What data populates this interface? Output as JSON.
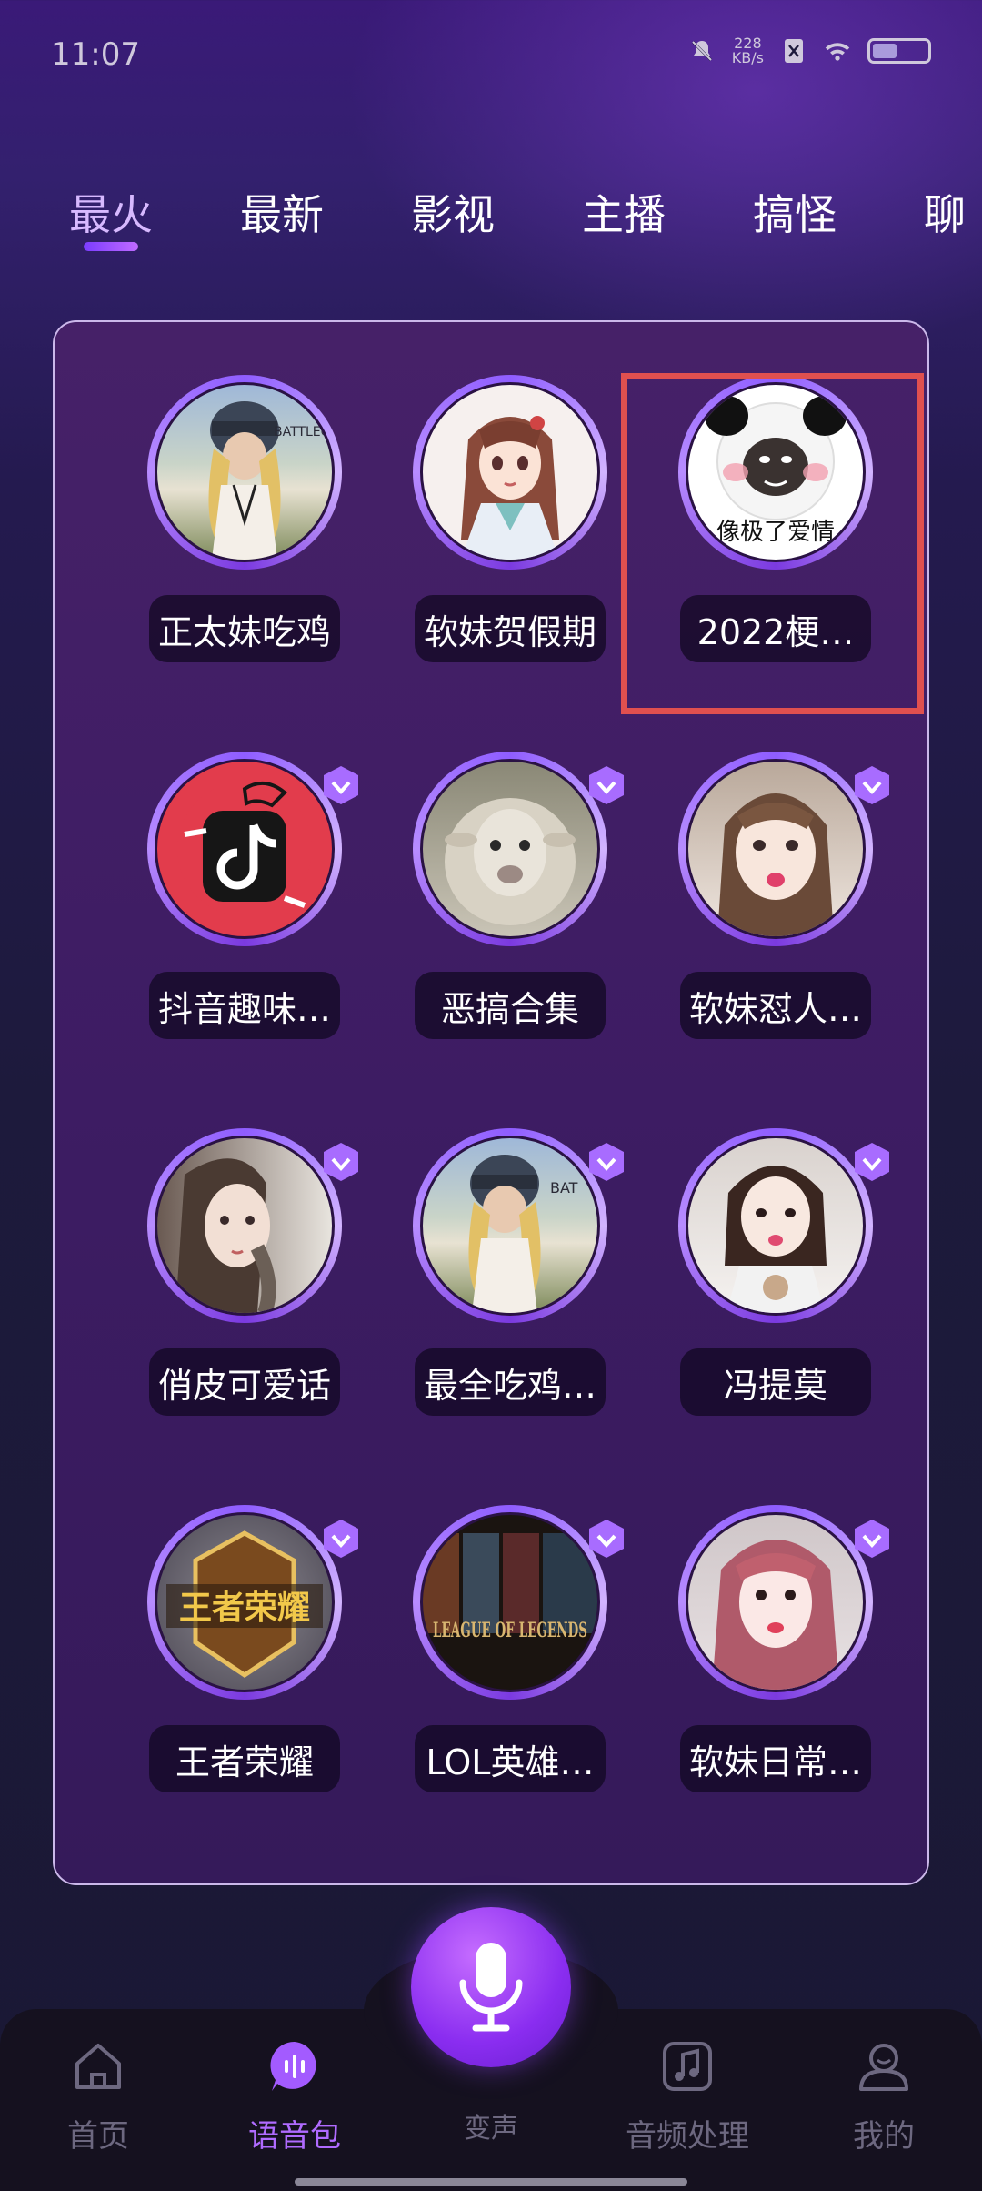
{
  "status_bar": {
    "time": "11:07",
    "net_speed_value": "228",
    "net_speed_unit": "KB/s"
  },
  "tabs": [
    {
      "label": "最火",
      "active": true
    },
    {
      "label": "最新",
      "active": false
    },
    {
      "label": "影视",
      "active": false
    },
    {
      "label": "主播",
      "active": false
    },
    {
      "label": "搞怪",
      "active": false
    },
    {
      "label": "聊",
      "active": false
    }
  ],
  "packs": [
    {
      "label": "正太妹吃鸡",
      "vip": false,
      "avatar": "pubg-girl",
      "avatar_text": "BATTLEG"
    },
    {
      "label": "软妹贺假期",
      "vip": false,
      "avatar": "anime-girl",
      "avatar_text": ""
    },
    {
      "label": "2022梗…",
      "vip": false,
      "avatar": "panda-meme",
      "avatar_text": "像极了爱情"
    },
    {
      "label": "抖音趣味…",
      "vip": true,
      "avatar": "tiktok-logo",
      "avatar_text": ""
    },
    {
      "label": "恶搞合集",
      "vip": true,
      "avatar": "sheep",
      "avatar_text": ""
    },
    {
      "label": "软妹怼人…",
      "vip": true,
      "avatar": "girl-photo",
      "avatar_text": ""
    },
    {
      "label": "俏皮可爱话",
      "vip": true,
      "avatar": "girl-photo-2",
      "avatar_text": ""
    },
    {
      "label": "最全吃鸡…",
      "vip": true,
      "avatar": "pubg-girl-2",
      "avatar_text": "BAT"
    },
    {
      "label": "冯提莫",
      "vip": true,
      "avatar": "girl-photo-3",
      "avatar_text": ""
    },
    {
      "label": "王者荣耀",
      "vip": true,
      "avatar": "honor-of-kings-logo",
      "avatar_text": "王者荣耀"
    },
    {
      "label": "LOL英雄…",
      "vip": true,
      "avatar": "league-of-legends-logo",
      "avatar_text": "LEAGUE OF LEGENDS"
    },
    {
      "label": "软妹日常…",
      "vip": true,
      "avatar": "girl-photo-4",
      "avatar_text": ""
    }
  ],
  "bottom_nav": [
    {
      "label": "首页",
      "icon": "home-icon",
      "active": false
    },
    {
      "label": "语音包",
      "icon": "voice-pack-icon",
      "active": true
    },
    {
      "label": "变声",
      "icon": "microphone-icon",
      "active": false
    },
    {
      "label": "音频处理",
      "icon": "music-note-icon",
      "active": false
    },
    {
      "label": "我的",
      "icon": "profile-icon",
      "active": false
    }
  ],
  "colors": {
    "accent": "#b06bff",
    "tab_active": "#d7b9ff",
    "highlight": "#e0504f"
  }
}
